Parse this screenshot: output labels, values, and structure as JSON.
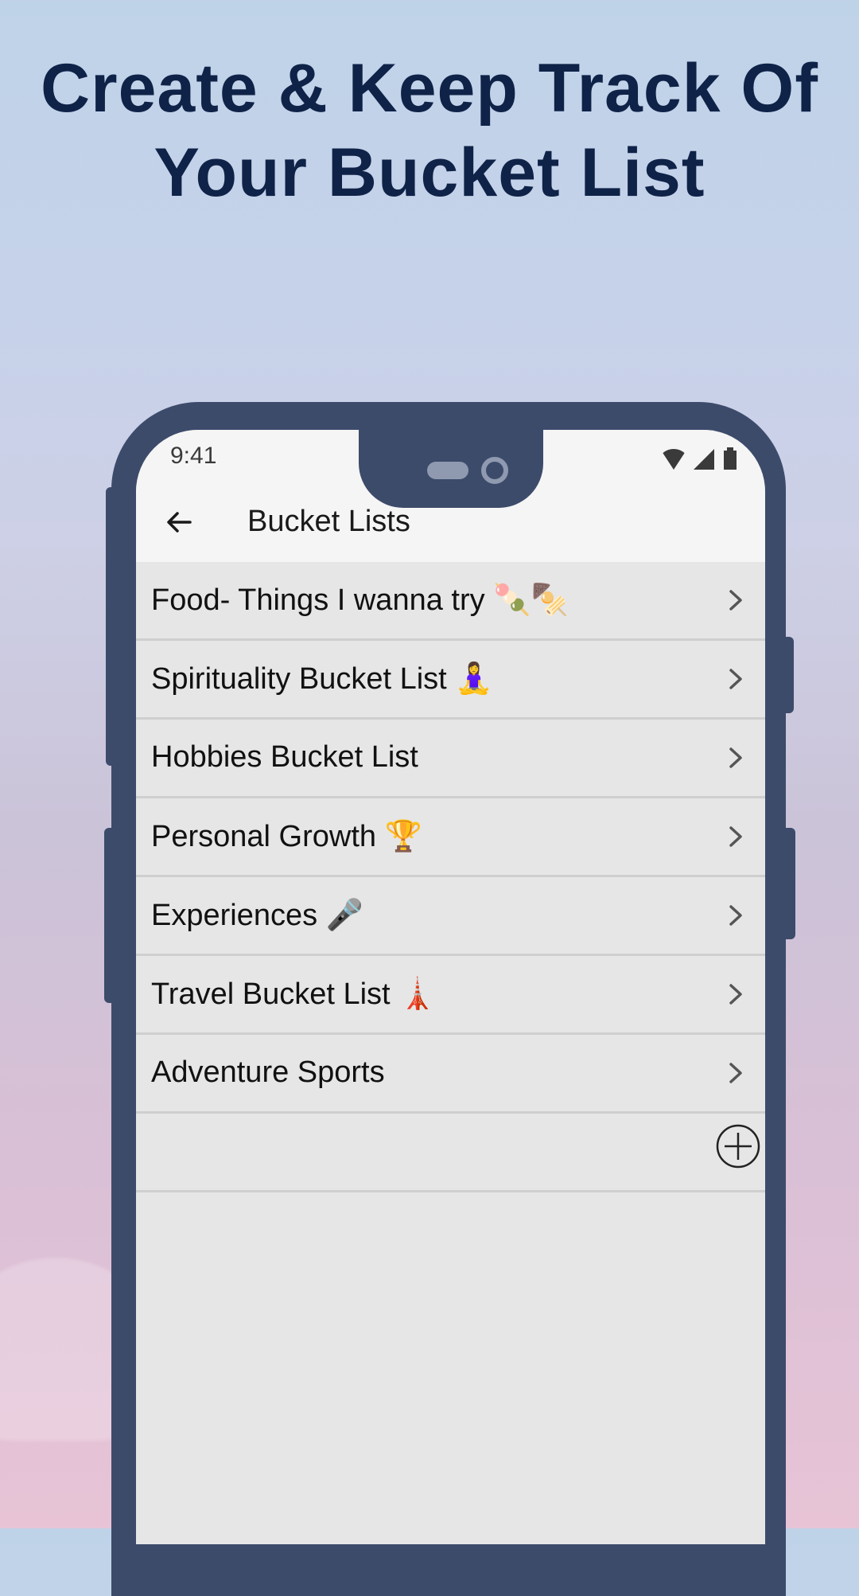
{
  "headline": {
    "line1": "Create & Keep Track Of",
    "line2": "Your Bucket List"
  },
  "status_bar": {
    "time": "9:41",
    "icons": [
      "wifi-icon",
      "cellular-signal-icon",
      "battery-icon"
    ]
  },
  "app_bar": {
    "back_icon": "arrow-left-icon",
    "title": "Bucket Lists"
  },
  "bucket_lists": [
    {
      "label": "Food- Things I wanna try 🍡🍢"
    },
    {
      "label": "Spirituality Bucket List 🧘‍♀️"
    },
    {
      "label": "Hobbies Bucket List"
    },
    {
      "label": "Personal Growth 🏆"
    },
    {
      "label": "Experiences 🎤"
    },
    {
      "label": "Travel Bucket List 🗼"
    },
    {
      "label": "Adventure Sports"
    }
  ],
  "add_button": {
    "icon": "plus-circle-icon"
  },
  "colors": {
    "headline": "#0f2248",
    "phone_frame": "#3d4b6b",
    "list_bg": "#e6e6e6",
    "app_bar_bg": "#f5f5f5"
  }
}
